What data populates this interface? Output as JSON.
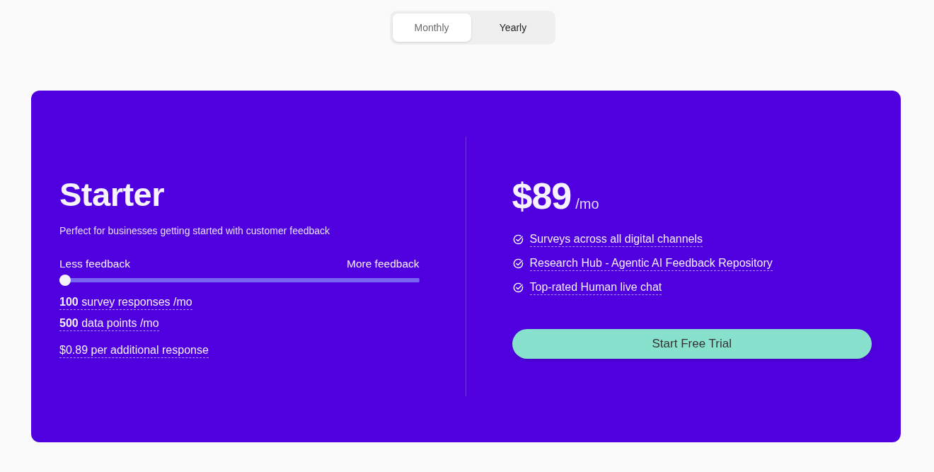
{
  "billing_toggle": {
    "options": [
      {
        "label": "Monthly",
        "selected": true
      },
      {
        "label": "Yearly",
        "selected": false
      }
    ]
  },
  "plan": {
    "name": "Starter",
    "description": "Perfect for businesses getting started with customer feedback",
    "slider": {
      "min_label": "Less feedback",
      "max_label": "More feedback",
      "level": 0
    },
    "limits": [
      "**100** survey responses /mo",
      "**500** data points /mo"
    ],
    "additional_rate": "$0.89 per additional response",
    "price": {
      "amount": "$89",
      "period": "/mo"
    },
    "features": [
      "Surveys across all digital channels",
      "Research Hub - Agentic AI Feedback Repository",
      "Top-rated Human live chat"
    ],
    "cta": "Start Free Trial"
  }
}
